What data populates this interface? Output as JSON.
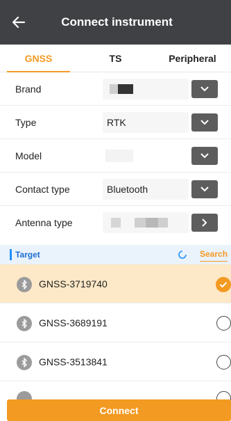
{
  "header": {
    "title": "Connect instrument",
    "back_icon": "arrow-left-icon"
  },
  "tabs": [
    {
      "label": "GNSS",
      "active": true
    },
    {
      "label": "TS",
      "active": false
    },
    {
      "label": "Peripheral",
      "active": false
    }
  ],
  "form": {
    "brand": {
      "label": "Brand",
      "value": ""
    },
    "type": {
      "label": "Type",
      "value": "RTK"
    },
    "model": {
      "label": "Model",
      "value": ""
    },
    "contact_type": {
      "label": "Contact type",
      "value": "Bluetooth"
    },
    "antenna_type": {
      "label": "Antenna type",
      "value": ""
    }
  },
  "target": {
    "label": "Target",
    "search_label": "Search"
  },
  "devices": [
    {
      "name": "GNSS-3719740",
      "selected": true
    },
    {
      "name": "GNSS-3689191",
      "selected": false
    },
    {
      "name": "GNSS-3513841",
      "selected": false
    }
  ],
  "connect_label": "Connect",
  "colors": {
    "accent": "#f39a22",
    "header_bg": "#3f4144",
    "selected_row": "#fde8c7",
    "target_blue": "#1e6fd0"
  }
}
